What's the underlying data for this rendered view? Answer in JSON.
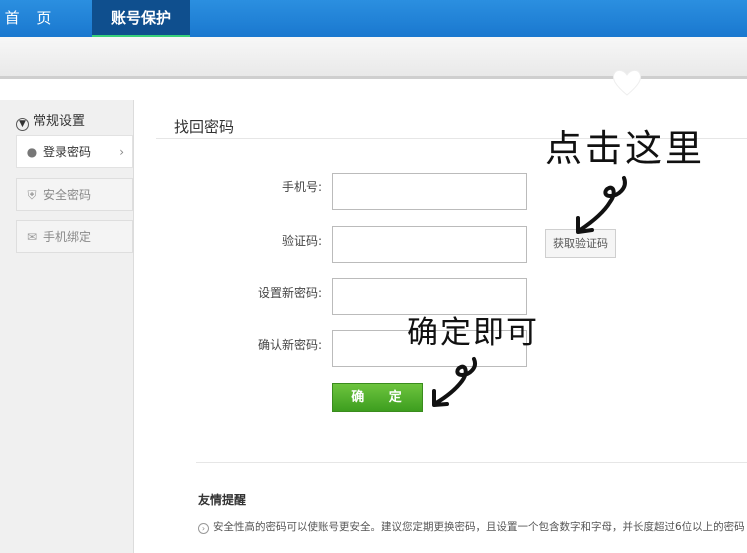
{
  "topnav": {
    "home_label": "首 页",
    "active_tab_label": "账号保护"
  },
  "sidebar": {
    "header": "常规设置",
    "items": [
      {
        "label": "登录密码",
        "icon": "user-icon"
      },
      {
        "label": "安全密码",
        "icon": "shield-icon"
      },
      {
        "label": "手机绑定",
        "icon": "mail-icon"
      }
    ]
  },
  "main": {
    "title": "找回密码",
    "fields": [
      {
        "label": "手机号:",
        "value": ""
      },
      {
        "label": "验证码:",
        "value": ""
      },
      {
        "label": "设置新密码:",
        "value": ""
      },
      {
        "label": "确认新密码:",
        "value": ""
      }
    ],
    "get_code_label": "获取验证码",
    "confirm_label": "确 定"
  },
  "tips": {
    "title": "友情提醒",
    "text": "安全性高的密码可以使账号更安全。建议您定期更换密码，且设置一个包含数字和字母，并长度超过6位以上的密码"
  },
  "annotations": {
    "click_here": "点击这里",
    "confirm_done": "确定即可"
  },
  "colors": {
    "nav_blue": "#1a78cf",
    "active_tab": "#0f4f8e",
    "confirm_green": "#4aaa28"
  }
}
